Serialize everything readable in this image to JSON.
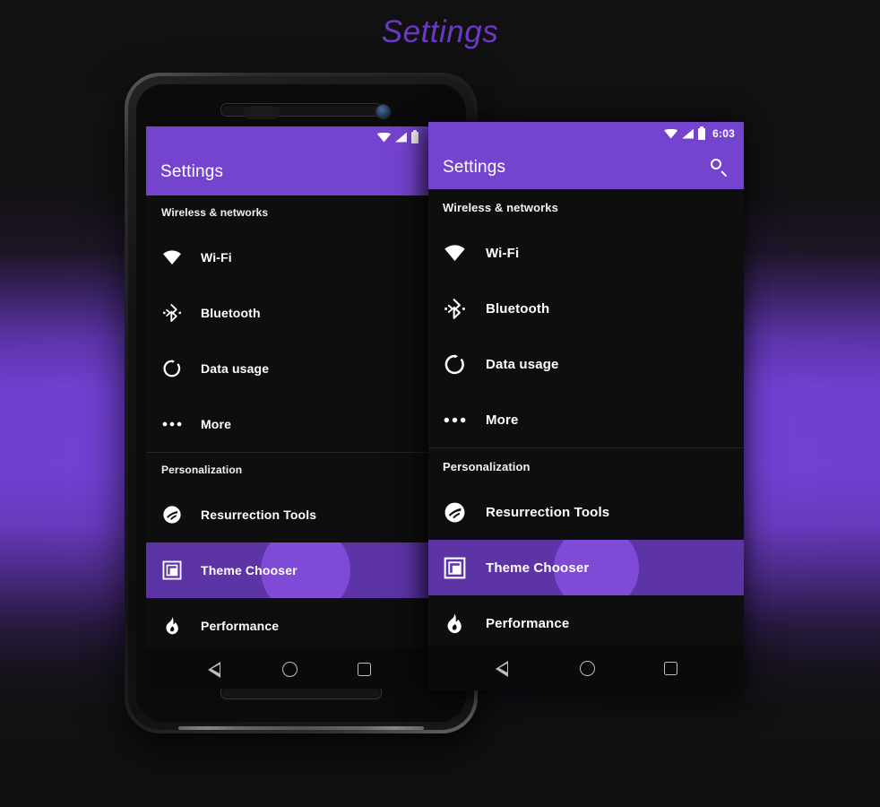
{
  "page": {
    "title": "Settings",
    "accent_purple": "#7544cf",
    "selected_row_bg": "#5c34a6",
    "ripple_color": "#7e4ad6",
    "screen_bg": "#0e0e0e",
    "title_color": "#6c39c4"
  },
  "status_bar": {
    "wifi_icon": "wifi-icon",
    "signal_icon": "cell-signal-icon",
    "battery_icon": "battery-icon",
    "time": "6:03"
  },
  "app_bar": {
    "title": "Settings",
    "search_icon": "search-icon"
  },
  "settings": {
    "sections": [
      {
        "header": "Wireless & networks",
        "items": [
          {
            "label": "Wi-Fi",
            "icon": "wifi-icon",
            "selected": false
          },
          {
            "label": "Bluetooth",
            "icon": "bluetooth-icon",
            "selected": false
          },
          {
            "label": "Data usage",
            "icon": "data-usage-icon",
            "selected": false
          },
          {
            "label": "More",
            "icon": "more-horizontal-icon",
            "selected": false
          }
        ]
      },
      {
        "header": "Personalization",
        "items": [
          {
            "label": "Resurrection Tools",
            "icon": "resurrection-remix-icon",
            "selected": false
          },
          {
            "label": "Theme Chooser",
            "icon": "theme-chooser-icon",
            "selected": true
          },
          {
            "label": "Performance",
            "icon": "flame-icon",
            "selected": false
          }
        ]
      }
    ]
  },
  "nav_bar": {
    "back": "back-nav-button",
    "home": "home-nav-button",
    "recents": "recents-nav-button"
  },
  "device": {
    "earpiece": "earpiece-speaker",
    "camera": "front-camera",
    "sensor": "proximity-sensor",
    "bottom_speaker": "bottom-speaker"
  }
}
